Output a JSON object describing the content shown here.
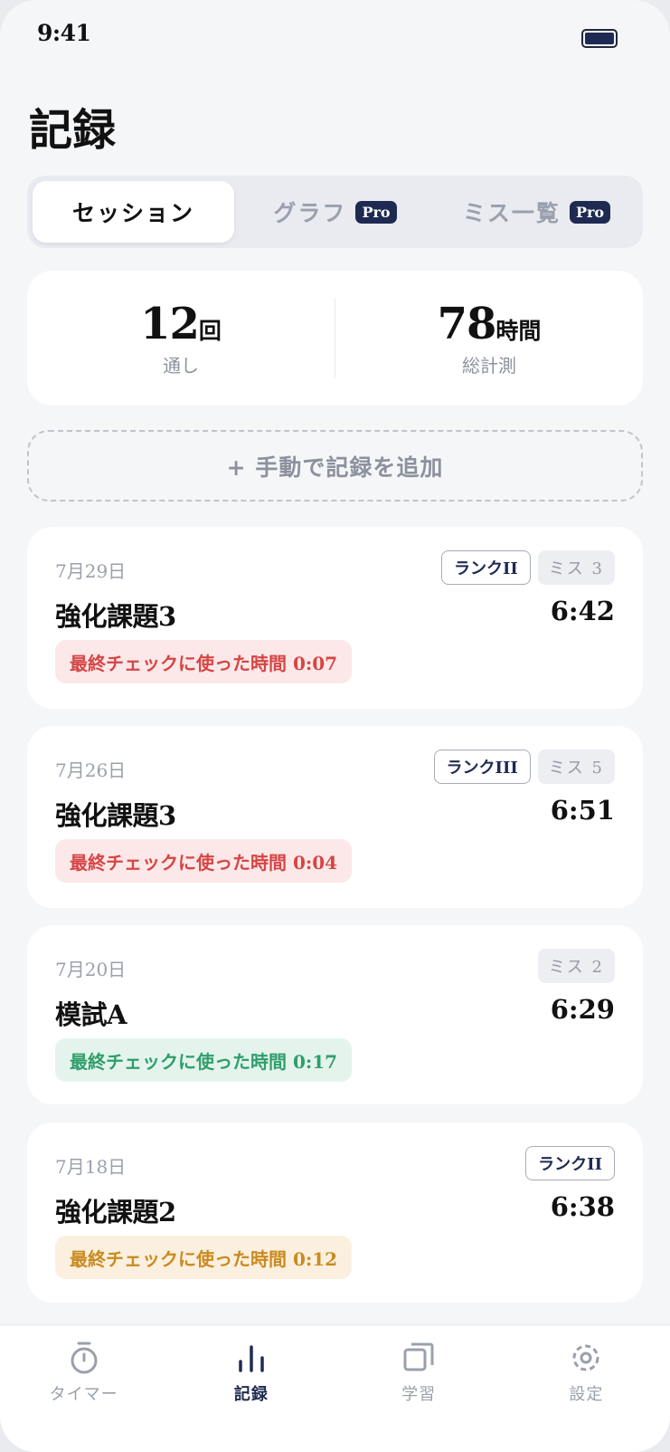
{
  "status": {
    "time": "9:41"
  },
  "page": {
    "title": "記録"
  },
  "segments": [
    {
      "label": "セッション",
      "active": true,
      "pro": ""
    },
    {
      "label": "グラフ",
      "active": false,
      "pro": "Pro"
    },
    {
      "label": "ミス一覧",
      "active": false,
      "pro": "Pro"
    }
  ],
  "stats": {
    "runs": {
      "value": "12",
      "unit": "回",
      "label": "通し"
    },
    "total": {
      "value": "78",
      "unit": "時間",
      "label": "総計測"
    }
  },
  "add_button": {
    "label": "+ 手動で記録を追加"
  },
  "sessions": [
    {
      "date": "7月29日",
      "rank": "ランクII",
      "miss": "ミス 3",
      "name": "強化課題3",
      "time": "6:42",
      "check": "最終チェックに使った時間 0:07",
      "check_color": "red"
    },
    {
      "date": "7月26日",
      "rank": "ランクIII",
      "miss": "ミス 5",
      "name": "強化課題3",
      "time": "6:51",
      "check": "最終チェックに使った時間 0:04",
      "check_color": "red"
    },
    {
      "date": "7月20日",
      "rank": "",
      "miss": "ミス 2",
      "name": "模試A",
      "time": "6:29",
      "check": "最終チェックに使った時間 0:17",
      "check_color": "green"
    },
    {
      "date": "7月18日",
      "rank": "ランクII",
      "miss": "",
      "name": "強化課題2",
      "time": "6:38",
      "check": "最終チェックに使った時間 0:12",
      "check_color": "amber"
    }
  ],
  "tabbar": {
    "timer": {
      "label": "タイマー",
      "icon": "stopwatch-icon"
    },
    "records": {
      "label": "記録",
      "icon": "bar-chart-icon",
      "active": true
    },
    "study": {
      "label": "学習",
      "icon": "cards-icon"
    },
    "settings": {
      "label": "設定",
      "icon": "gear-icon"
    }
  },
  "colors": {
    "navy": "#1f2a52",
    "red_text": "#d64545",
    "red_bg": "#fce8e8",
    "green_text": "#2f9e6b",
    "green_bg": "#e4f4ec",
    "amber_text": "#cb8a1f",
    "amber_bg": "#fbf0df"
  }
}
